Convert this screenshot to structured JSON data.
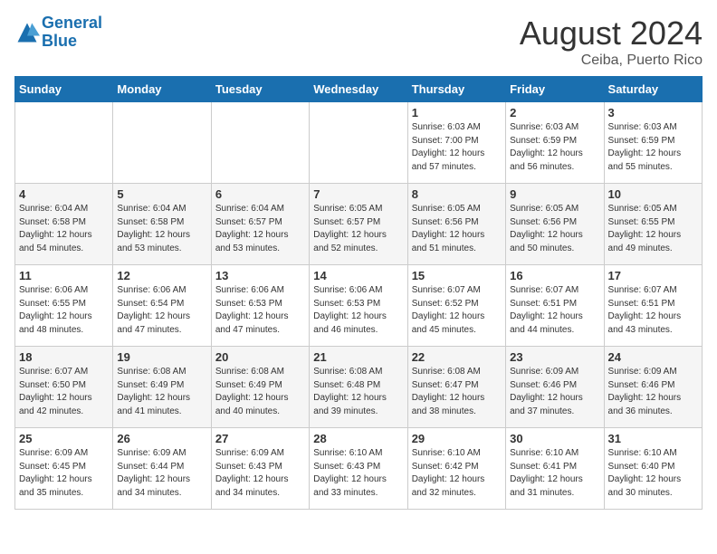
{
  "header": {
    "logo_line1": "General",
    "logo_line2": "Blue",
    "month_year": "August 2024",
    "location": "Ceiba, Puerto Rico"
  },
  "weekdays": [
    "Sunday",
    "Monday",
    "Tuesday",
    "Wednesday",
    "Thursday",
    "Friday",
    "Saturday"
  ],
  "weeks": [
    [
      {
        "day": "",
        "info": ""
      },
      {
        "day": "",
        "info": ""
      },
      {
        "day": "",
        "info": ""
      },
      {
        "day": "",
        "info": ""
      },
      {
        "day": "1",
        "info": "Sunrise: 6:03 AM\nSunset: 7:00 PM\nDaylight: 12 hours\nand 57 minutes."
      },
      {
        "day": "2",
        "info": "Sunrise: 6:03 AM\nSunset: 6:59 PM\nDaylight: 12 hours\nand 56 minutes."
      },
      {
        "day": "3",
        "info": "Sunrise: 6:03 AM\nSunset: 6:59 PM\nDaylight: 12 hours\nand 55 minutes."
      }
    ],
    [
      {
        "day": "4",
        "info": "Sunrise: 6:04 AM\nSunset: 6:58 PM\nDaylight: 12 hours\nand 54 minutes."
      },
      {
        "day": "5",
        "info": "Sunrise: 6:04 AM\nSunset: 6:58 PM\nDaylight: 12 hours\nand 53 minutes."
      },
      {
        "day": "6",
        "info": "Sunrise: 6:04 AM\nSunset: 6:57 PM\nDaylight: 12 hours\nand 53 minutes."
      },
      {
        "day": "7",
        "info": "Sunrise: 6:05 AM\nSunset: 6:57 PM\nDaylight: 12 hours\nand 52 minutes."
      },
      {
        "day": "8",
        "info": "Sunrise: 6:05 AM\nSunset: 6:56 PM\nDaylight: 12 hours\nand 51 minutes."
      },
      {
        "day": "9",
        "info": "Sunrise: 6:05 AM\nSunset: 6:56 PM\nDaylight: 12 hours\nand 50 minutes."
      },
      {
        "day": "10",
        "info": "Sunrise: 6:05 AM\nSunset: 6:55 PM\nDaylight: 12 hours\nand 49 minutes."
      }
    ],
    [
      {
        "day": "11",
        "info": "Sunrise: 6:06 AM\nSunset: 6:55 PM\nDaylight: 12 hours\nand 48 minutes."
      },
      {
        "day": "12",
        "info": "Sunrise: 6:06 AM\nSunset: 6:54 PM\nDaylight: 12 hours\nand 47 minutes."
      },
      {
        "day": "13",
        "info": "Sunrise: 6:06 AM\nSunset: 6:53 PM\nDaylight: 12 hours\nand 47 minutes."
      },
      {
        "day": "14",
        "info": "Sunrise: 6:06 AM\nSunset: 6:53 PM\nDaylight: 12 hours\nand 46 minutes."
      },
      {
        "day": "15",
        "info": "Sunrise: 6:07 AM\nSunset: 6:52 PM\nDaylight: 12 hours\nand 45 minutes."
      },
      {
        "day": "16",
        "info": "Sunrise: 6:07 AM\nSunset: 6:51 PM\nDaylight: 12 hours\nand 44 minutes."
      },
      {
        "day": "17",
        "info": "Sunrise: 6:07 AM\nSunset: 6:51 PM\nDaylight: 12 hours\nand 43 minutes."
      }
    ],
    [
      {
        "day": "18",
        "info": "Sunrise: 6:07 AM\nSunset: 6:50 PM\nDaylight: 12 hours\nand 42 minutes."
      },
      {
        "day": "19",
        "info": "Sunrise: 6:08 AM\nSunset: 6:49 PM\nDaylight: 12 hours\nand 41 minutes."
      },
      {
        "day": "20",
        "info": "Sunrise: 6:08 AM\nSunset: 6:49 PM\nDaylight: 12 hours\nand 40 minutes."
      },
      {
        "day": "21",
        "info": "Sunrise: 6:08 AM\nSunset: 6:48 PM\nDaylight: 12 hours\nand 39 minutes."
      },
      {
        "day": "22",
        "info": "Sunrise: 6:08 AM\nSunset: 6:47 PM\nDaylight: 12 hours\nand 38 minutes."
      },
      {
        "day": "23",
        "info": "Sunrise: 6:09 AM\nSunset: 6:46 PM\nDaylight: 12 hours\nand 37 minutes."
      },
      {
        "day": "24",
        "info": "Sunrise: 6:09 AM\nSunset: 6:46 PM\nDaylight: 12 hours\nand 36 minutes."
      }
    ],
    [
      {
        "day": "25",
        "info": "Sunrise: 6:09 AM\nSunset: 6:45 PM\nDaylight: 12 hours\nand 35 minutes."
      },
      {
        "day": "26",
        "info": "Sunrise: 6:09 AM\nSunset: 6:44 PM\nDaylight: 12 hours\nand 34 minutes."
      },
      {
        "day": "27",
        "info": "Sunrise: 6:09 AM\nSunset: 6:43 PM\nDaylight: 12 hours\nand 34 minutes."
      },
      {
        "day": "28",
        "info": "Sunrise: 6:10 AM\nSunset: 6:43 PM\nDaylight: 12 hours\nand 33 minutes."
      },
      {
        "day": "29",
        "info": "Sunrise: 6:10 AM\nSunset: 6:42 PM\nDaylight: 12 hours\nand 32 minutes."
      },
      {
        "day": "30",
        "info": "Sunrise: 6:10 AM\nSunset: 6:41 PM\nDaylight: 12 hours\nand 31 minutes."
      },
      {
        "day": "31",
        "info": "Sunrise: 6:10 AM\nSunset: 6:40 PM\nDaylight: 12 hours\nand 30 minutes."
      }
    ]
  ]
}
